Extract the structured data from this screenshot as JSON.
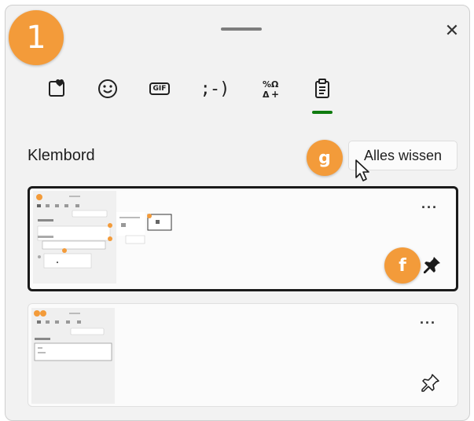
{
  "step_badge": "1",
  "close_glyph": "✕",
  "tabs": [
    {
      "name": "kaomoji-heart-icon",
      "selected": false
    },
    {
      "name": "emoji-icon",
      "selected": false
    },
    {
      "name": "gif-icon",
      "label": "GIF",
      "selected": false
    },
    {
      "name": "kaomoji-icon",
      "label": ";-)",
      "selected": false
    },
    {
      "name": "symbols-icon",
      "selected": false
    },
    {
      "name": "clipboard-icon",
      "selected": true
    }
  ],
  "accent_color": "#0f7b0f",
  "badge_color": "#f39b3a",
  "clipboard": {
    "title": "Klembord",
    "clear_all_label": "Alles wissen",
    "clear_badge": "g",
    "items": [
      {
        "more_glyph": "···",
        "pinned": true,
        "pin_badge": "f",
        "selected": true
      },
      {
        "more_glyph": "···",
        "pinned": false,
        "selected": false
      }
    ]
  }
}
